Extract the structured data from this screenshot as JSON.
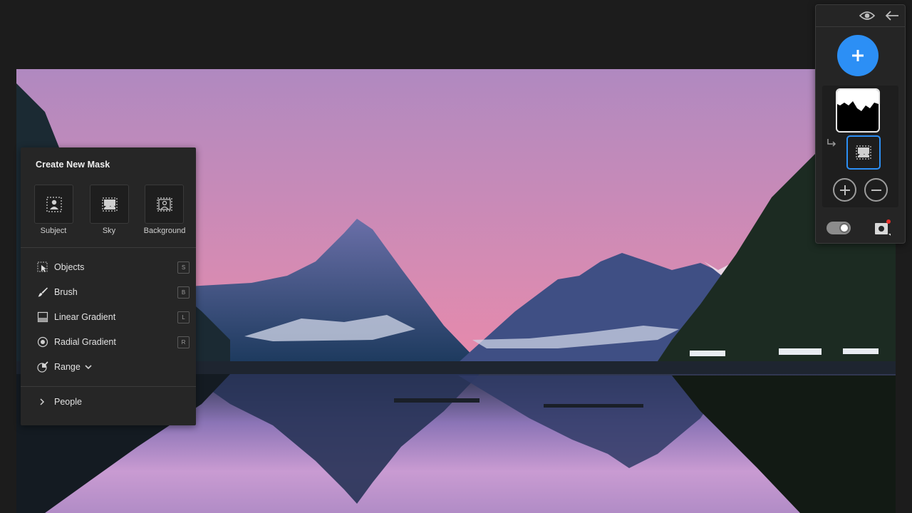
{
  "create_mask_panel": {
    "title": "Create New Mask",
    "quick_masks": [
      {
        "label": "Subject",
        "icon": "select-subject-icon"
      },
      {
        "label": "Sky",
        "icon": "select-sky-icon"
      },
      {
        "label": "Background",
        "icon": "select-background-icon"
      }
    ],
    "tools": [
      {
        "label": "Objects",
        "shortcut": "S",
        "icon": "objects-icon"
      },
      {
        "label": "Brush",
        "shortcut": "B",
        "icon": "brush-icon"
      },
      {
        "label": "Linear Gradient",
        "shortcut": "L",
        "icon": "linear-gradient-icon"
      },
      {
        "label": "Radial Gradient",
        "shortcut": "R",
        "icon": "radial-gradient-icon"
      },
      {
        "label": "Range",
        "icon": "range-icon"
      }
    ],
    "people_label": "People"
  },
  "masks_panel": {
    "header_icons": [
      "eye-icon",
      "back-arrow-icon"
    ],
    "add_button_icon": "plus-icon",
    "accent_color": "#2c8ff5",
    "add_icon": "add-circle-icon",
    "subtract_icon": "subtract-circle-icon",
    "overlay_toggle_on": true
  }
}
